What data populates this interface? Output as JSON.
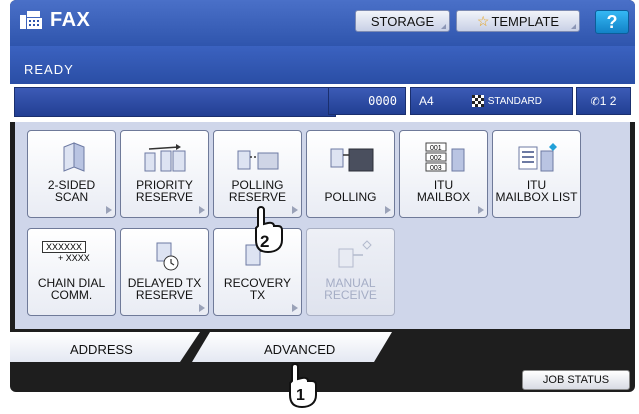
{
  "header": {
    "title": "FAX",
    "storage_label": "STORAGE",
    "template_label": "TEMPLATE",
    "help_label": "?"
  },
  "status": {
    "text": "READY"
  },
  "info": {
    "counter": "0000",
    "paper": "A4",
    "quality": "STANDARD",
    "lines": "1  2"
  },
  "buttons": [
    {
      "label": "2-SIDED\nSCAN",
      "enabled": true
    },
    {
      "label": "PRIORITY\nRESERVE",
      "enabled": true
    },
    {
      "label": "POLLING\nRESERVE",
      "enabled": true
    },
    {
      "label": "POLLING",
      "enabled": true
    },
    {
      "label": "ITU\nMAILBOX",
      "enabled": true
    },
    {
      "label": "ITU\nMAILBOX LIST",
      "enabled": true
    },
    {
      "label": "CHAIN DIAL\nCOMM.",
      "enabled": true,
      "icon_text_top": "XXXXXX",
      "icon_text_bottom": "+ XXXX"
    },
    {
      "label": "DELAYED TX\nRESERVE",
      "enabled": true
    },
    {
      "label": "RECOVERY\nTX",
      "enabled": true
    },
    {
      "label": "MANUAL\nRECEIVE",
      "enabled": false
    }
  ],
  "tabs": {
    "address": "ADDRESS",
    "advanced": "ADVANCED",
    "active": "advanced"
  },
  "footer": {
    "job_status": "JOB STATUS"
  },
  "callouts": {
    "step1": "1",
    "step2": "2"
  },
  "colors": {
    "title_blue": "#2f55ad",
    "accent_orange": "#f0a020",
    "help_blue": "#1282c7"
  }
}
